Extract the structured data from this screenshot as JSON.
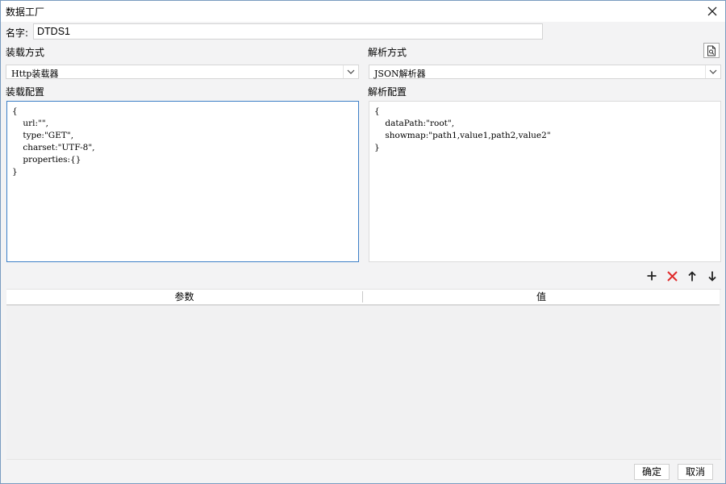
{
  "window": {
    "title": "数据工厂",
    "close_icon": "close-icon"
  },
  "name": {
    "label": "名字:",
    "value": "DTDS1"
  },
  "loader": {
    "label": "装载方式",
    "selected": "Http装载器",
    "config_label": "装载配置",
    "config_text": "{\n    url:\"\",\n    type:\"GET\",\n    charset:\"UTF-8\",\n    properties:{}\n}"
  },
  "parser": {
    "label": "解析方式",
    "selected": "JSON解析器",
    "config_label": "解析配置",
    "config_text": "{\n    dataPath:\"root\",\n    showmap:\"path1,value1,path2,value2\"\n}"
  },
  "toolbar": {
    "icons": [
      "add-icon",
      "delete-icon",
      "move-up-icon",
      "move-down-icon"
    ],
    "delete_color": "#e02a2a"
  },
  "table": {
    "columns": [
      "参数",
      "值"
    ],
    "rows": []
  },
  "buttons": {
    "ok": "确定",
    "cancel": "取消"
  },
  "colors": {
    "focus_border": "#3c7fc7",
    "dialog_bg": "#f3f3f4"
  }
}
